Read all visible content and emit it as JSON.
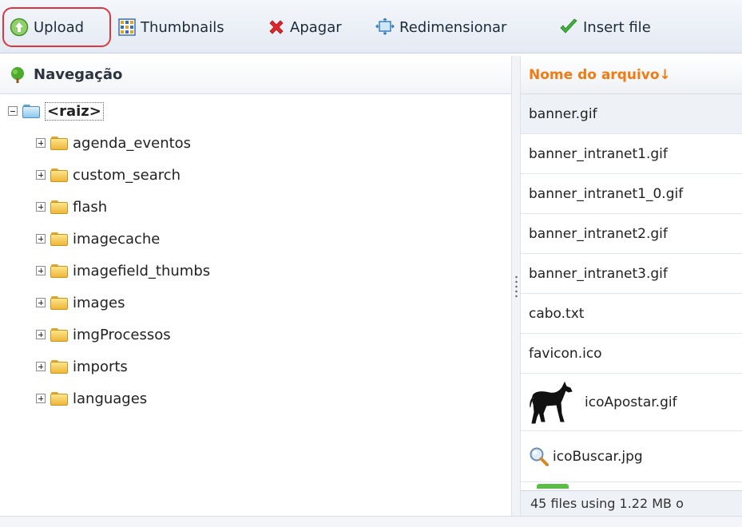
{
  "toolbar": {
    "upload": "Upload",
    "thumbnails": "Thumbnails",
    "delete": "Apagar",
    "resize": "Redimensionar",
    "insert": "Insert file"
  },
  "nav": {
    "title": "Navegação",
    "root": "<raiz>",
    "folders": [
      "agenda_eventos",
      "custom_search",
      "flash",
      "imagecache",
      "imagefield_thumbs",
      "images",
      "imgProcessos",
      "imports",
      "languages"
    ]
  },
  "files": {
    "header": "Nome do arquivo↓",
    "rows": [
      "banner.gif",
      "banner_intranet1.gif",
      "banner_intranet1_0.gif",
      "banner_intranet2.gif",
      "banner_intranet3.gif",
      "cabo.txt",
      "favicon.ico",
      "icoApostar.gif",
      "icoBuscar.jpg"
    ],
    "footer": "45 files using 1.22 MB o"
  },
  "colors": {
    "accent": "#f07b13",
    "highlight_ring": "#d9383f"
  }
}
